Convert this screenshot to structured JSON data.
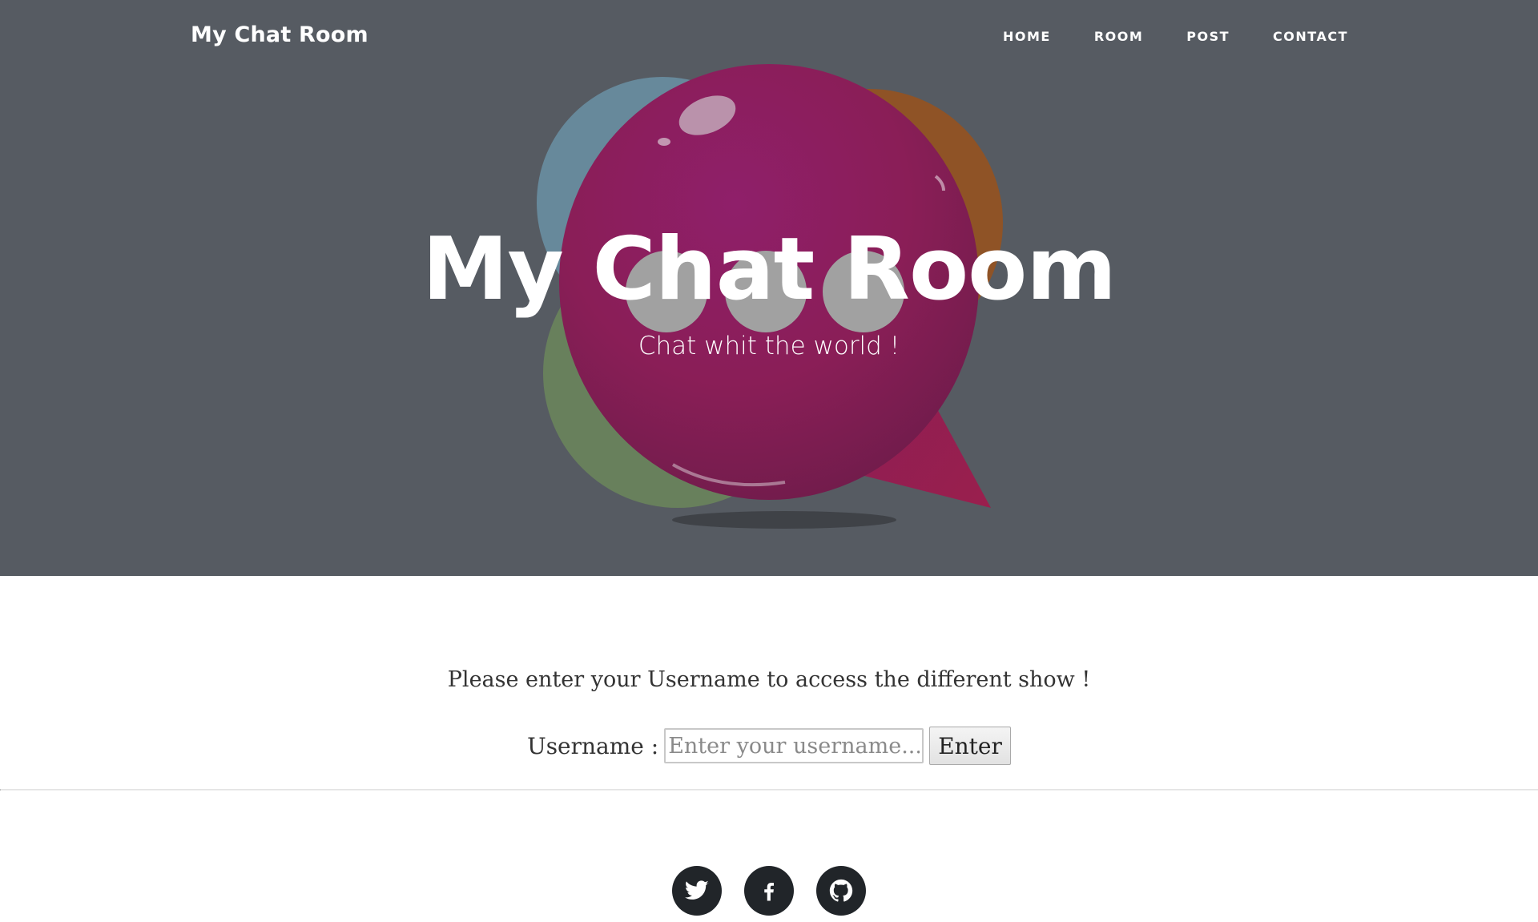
{
  "navbar": {
    "brand": "My Chat Room",
    "links": [
      "HOME",
      "ROOM",
      "POST",
      "CONTACT"
    ]
  },
  "hero": {
    "title": "My Chat Room",
    "subtitle": "Chat whit the world !",
    "background_color": "#565b62"
  },
  "main": {
    "intro": "Please enter your Username to access the different show !",
    "username_label": "Username :",
    "username_placeholder": "Enter your username...",
    "username_value": "",
    "enter_button": "Enter"
  },
  "footer": {
    "social_icons": [
      "twitter-icon",
      "facebook-icon",
      "github-icon"
    ],
    "icon_color": "#212529"
  }
}
